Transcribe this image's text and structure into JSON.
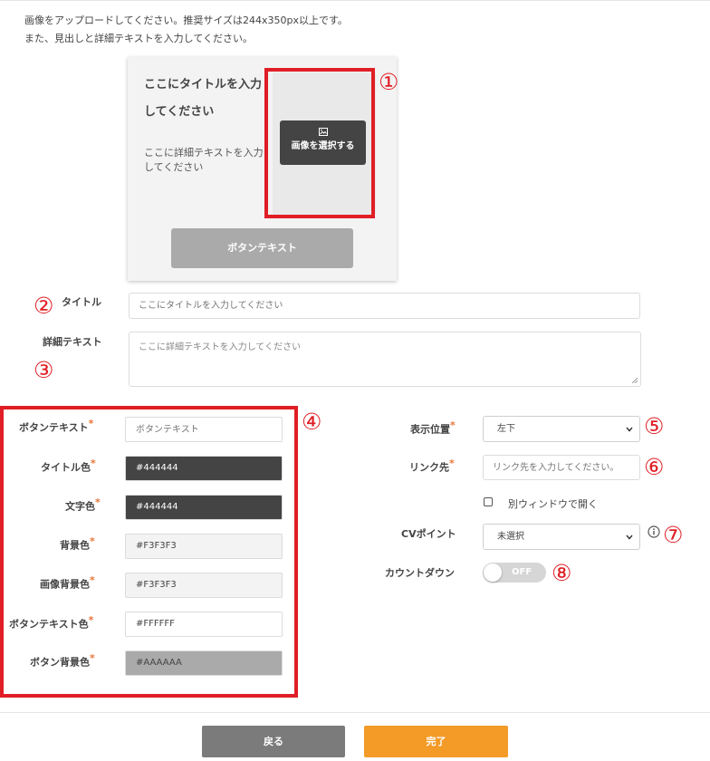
{
  "intro": {
    "line1": "画像をアップロードしてください。推奨サイズは244x350px以上です。",
    "line2": "また、見出しと詳細テキストを入力してください。"
  },
  "preview": {
    "title": "ここにタイトルを入力してください",
    "detail": "ここに詳細テキストを入力してください",
    "image_button": "画像を選択する",
    "button_text": "ボタンテキスト"
  },
  "annotations": [
    "①",
    "②",
    "③",
    "④",
    "⑤",
    "⑥",
    "⑦",
    "⑧"
  ],
  "form": {
    "title_label": "タイトル",
    "title_placeholder": "ここにタイトルを入力してください",
    "detail_label": "詳細テキスト",
    "detail_placeholder": "ここに詳細テキストを入力してください"
  },
  "colors_section": {
    "required_mark": "*",
    "fields": [
      {
        "label": "ボタンテキスト",
        "value": "",
        "placeholder": "ボタンテキスト",
        "bg": "#FFFFFF",
        "fg": "#888888"
      },
      {
        "label": "タイトル色",
        "value": "#444444",
        "bg": "#444444",
        "fg": "#FFFFFF"
      },
      {
        "label": "文字色",
        "value": "#444444",
        "bg": "#444444",
        "fg": "#FFFFFF"
      },
      {
        "label": "背景色",
        "value": "#F3F3F3",
        "bg": "#F3F3F3",
        "fg": "#444444"
      },
      {
        "label": "画像背景色",
        "value": "#F3F3F3",
        "bg": "#F3F3F3",
        "fg": "#444444"
      },
      {
        "label": "ボタンテキスト色",
        "value": "#FFFFFF",
        "bg": "#FFFFFF",
        "fg": "#444444"
      },
      {
        "label": "ボタン背景色",
        "value": "#AAAAAA",
        "bg": "#AAAAAA",
        "fg": "#444444"
      }
    ]
  },
  "settings": {
    "position_label": "表示位置",
    "position_value": "左下",
    "link_label": "リンク先",
    "link_placeholder": "リンク先を入力してください。",
    "new_window_label": "別ウィンドウで開く",
    "new_window_checked": false,
    "cv_label": "CVポイント",
    "cv_value": "未選択",
    "countdown_label": "カウントダウン",
    "countdown_state": "OFF"
  },
  "footer": {
    "back": "戻る",
    "done": "完了"
  },
  "theme": {
    "annotation_red": "#E01E25",
    "required_orange": "#E8743B",
    "done_orange": "#F39A27",
    "back_gray": "#7B7B7B"
  },
  "icons": [
    "image-icon",
    "chevron-down-icon",
    "info-icon",
    "resize-handle-icon"
  ]
}
